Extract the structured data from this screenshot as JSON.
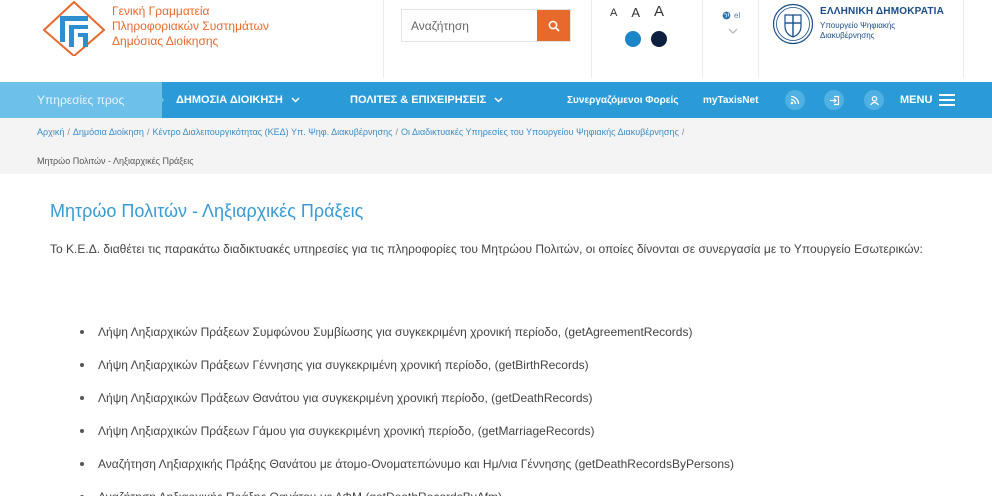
{
  "header": {
    "org_line1": "Γενική Γραμματεία",
    "org_line2": "Πληροφοριακών Συστημάτων",
    "org_line3": "Δημόσιας Διοίκησης",
    "search_placeholder": "Αναζήτηση",
    "font_sizes": [
      "A",
      "A",
      "A"
    ],
    "contrast_colors": [
      "#1a86c8",
      "#0d1f40"
    ],
    "language": "el",
    "gov_title": "ΕΛΛΗΝΙΚΗ ΔΗΜΟΚΡΑΤΙΑ",
    "gov_subtitle_line1": "Υπουργείο Ψηφιακής",
    "gov_subtitle_line2": "Διακυβέρνησης"
  },
  "nav": {
    "services_label": "Υπηρεσίες προς",
    "public_admin": "ΔΗΜΟΣΙΑ ΔΙΟΙΚΗΣΗ",
    "citizens_business": "ΠΟΛΙΤΕΣ & ΕΠΙΧΕΙΡΗΣΕΙΣ",
    "partners": "Συνεργαζόμενοι Φορείς",
    "mytaxisnet": "myTaxisNet",
    "menu": "MENU",
    "icons": [
      "rss-icon",
      "login-icon",
      "user-icon",
      "hamburger-icon"
    ]
  },
  "breadcrumb": {
    "items": [
      "Αρχική",
      "Δημόσια Διοίκηση",
      "Κέντρο Διαλειτουργικότητας (ΚΕΔ) Υπ. Ψηφ. Διακυβέρνησης",
      "Οι Διαδικτυακές Υπηρεσίες του Υπουργείου Ψηφιακής Διακυβέρνησης"
    ],
    "current": "Μητρώο Πολιτών - Ληξιαρχικές Πράξεις"
  },
  "content": {
    "title": "Μητρώο Πολιτών - Ληξιαρχικές Πράξεις",
    "intro": "Το Κ.Ε.Δ. διαθέτει τις παρακάτω διαδικτυακές υπηρεσίες για τις πληροφορίες του Μητρώου Πολιτών, οι οποίες δίνονται σε συνεργασία με το Υπουργείο Εσωτερικών:",
    "services": [
      "Λήψη Ληξιαρχικών Πράξεων Συμφώνου Συμβίωσης για συγκεκριμένη χρονική περίοδο, (getAgreementRecords)",
      "Λήψη Ληξιαρχικών Πράξεων Γέννησης για συγκεκριμένη χρονική περίοδο, (getBirthRecords)",
      "Λήψη Ληξιαρχικών Πράξεων Θανάτου για συγκεκριμένη χρονική περίοδο, (getDeathRecords)",
      "Λήψη Ληξιαρχικών Πράξεων Γάμου για συγκεκριμένη χρονική περίοδο, (getMarriageRecords)",
      "Αναζήτηση Ληξιαρχικής Πράξης Θανάτου με άτομο-Ονοματεπώνυμο και Ημ/νια Γέννησης (getDeathRecordsByPersons)",
      "Αναζήτηση Ληξιαρχικής Πράξης Θανάτου με ΑΦΜ (getDeathRecordsByAfm)"
    ]
  },
  "colors": {
    "accent_orange": "#e8692c",
    "nav_blue": "#2b9bd8",
    "nav_light_blue": "#6cc0ea",
    "title_blue": "#3a9ad4",
    "gov_blue": "#1b4d86"
  }
}
